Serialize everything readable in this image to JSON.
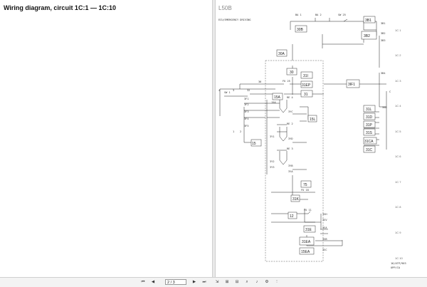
{
  "left_page": {
    "title": "Wiring diagram, circuit 1C:1 — 1C:10"
  },
  "diagram": {
    "header_code": "L50B",
    "subtitle": "ECU/EMERGENCY DRIVING",
    "footer_code": "16/ATP/903",
    "footer_sub": "UPP/CA",
    "sections": [
      "1C 1",
      "1C 2",
      "1C 3",
      "1C 4",
      "1C 5",
      "1C 6",
      "1C 7",
      "1C 8",
      "1C 9",
      "1C 10"
    ],
    "boxes": {
      "b3B1": "3B1",
      "b30B": "30B",
      "b3B2": "3B2",
      "b30A": "30A",
      "b30": "30",
      "b31I": "31I",
      "b31EP": "31EP",
      "b31": "31",
      "b3IF1": "3IF1",
      "b15A": "15A",
      "b31L": "31L",
      "b31D": "31D",
      "b31P": "31P",
      "b31S": "31S",
      "b31CA": "31CA",
      "b31C": "31C",
      "b15": "15",
      "b31E": "31E",
      "b15EA": "15EA",
      "b31EA": "31EA",
      "b15L": "15L",
      "b31K": "31K",
      "b12": "12",
      "b75": "75"
    },
    "labels": {
      "ba1": "BA 1",
      "ba2": "BA 2",
      "sw25": "SW 25",
      "sw1": "SW 1",
      "fu25": "FU 25",
      "fu18": "FU 18",
      "fu11": "FU 11",
      "re4": "RE 4",
      "re2": "RE 2",
      "re3": "RE 3",
      "c": "C",
      "tp": "T P",
      "n1": "3B1",
      "n2": "3B2",
      "n3": "3B3",
      "n4": "3B4",
      "n5": "32",
      "n6": "36",
      "n7": "3F1",
      "n8": "3F2",
      "n9": "3F3",
      "n10": "3F4",
      "n11": "3F5",
      "n12": "15A",
      "n13": "3YC",
      "n14": "3YD",
      "n15": "3YB",
      "n16": "3YA",
      "n17": "3Y1",
      "n18": "3Y2",
      "n19": "3Y3",
      "n20": "3SH",
      "n21": "3SV",
      "n22": "3SA",
      "n23": "3SB",
      "n24": "3SC",
      "n25": "3SD",
      "n26": "4",
      "n27": "3",
      "n28": "1",
      "n29": "2"
    }
  },
  "toolbar": {
    "page_value": "2 / 3",
    "tools": [
      "⏮",
      "◀",
      "▶",
      "⏭",
      "⇲",
      "⊞",
      "⊟",
      "⌕",
      "♪",
      "⚙",
      "⋮"
    ]
  }
}
